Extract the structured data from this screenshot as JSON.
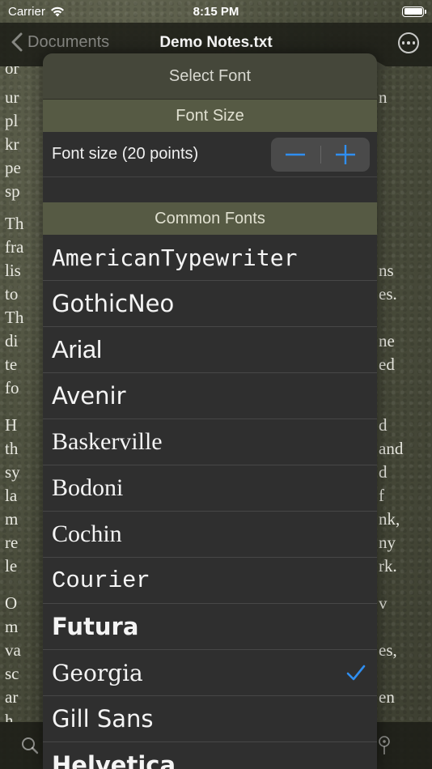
{
  "status_bar": {
    "carrier": "Carrier",
    "time": "8:15 PM"
  },
  "nav": {
    "back_label": "Documents",
    "title": "Demo Notes.txt"
  },
  "document": {
    "left_fragments": [
      "or",
      "ur",
      "pl",
      "kr",
      "pe",
      "sp",
      "Th",
      "fra",
      "lis",
      "to",
      "Th",
      "di",
      "te",
      "fo",
      "H",
      "th",
      "sy",
      "la",
      "m",
      "re",
      "le",
      "O",
      "m",
      "va",
      "sc",
      "ar",
      "h"
    ],
    "right_fragments": [
      "n",
      "ns",
      "es.",
      "ne",
      "ed",
      "d",
      "and",
      "d",
      "f",
      "nk,",
      "ny",
      "rk.",
      "v",
      "es,",
      "en"
    ]
  },
  "popover": {
    "title": "Select Font",
    "font_size_section": "Font Size",
    "font_size_label": "Font size (20 points)",
    "common_fonts_section": "Common Fonts",
    "fonts": [
      {
        "name": "AmericanTypewriter",
        "selected": false
      },
      {
        "name": "GothicNeo",
        "selected": false
      },
      {
        "name": "Arial",
        "selected": false
      },
      {
        "name": "Avenir",
        "selected": false
      },
      {
        "name": "Baskerville",
        "selected": false
      },
      {
        "name": "Bodoni",
        "selected": false
      },
      {
        "name": "Cochin",
        "selected": false
      },
      {
        "name": "Courier",
        "selected": false
      },
      {
        "name": "Futura",
        "selected": false
      },
      {
        "name": "Georgia",
        "selected": true
      },
      {
        "name": "Gill Sans",
        "selected": false
      },
      {
        "name": "Helvetica",
        "selected": false
      }
    ]
  },
  "colors": {
    "accent": "#2f8ef0",
    "section_header": "#565a44",
    "popover_bg": "#2f2f2f"
  },
  "icons": {
    "back": "chevron-left-icon",
    "more": "more-circle-icon",
    "search": "search-icon",
    "location": "location-pin-icon",
    "check": "checkmark-icon",
    "minus": "minus-icon",
    "plus": "plus-icon"
  }
}
